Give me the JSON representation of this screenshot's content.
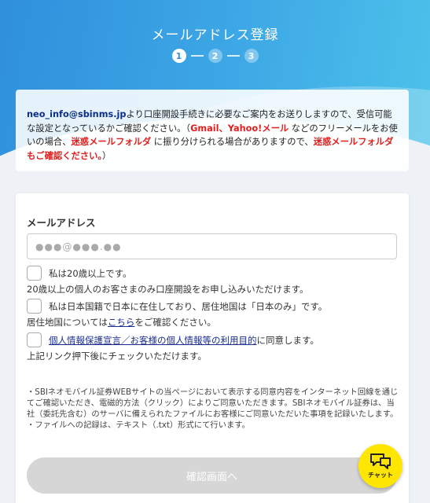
{
  "header": {
    "title": "メールアドレス登録",
    "steps": [
      "1",
      "2",
      "3"
    ],
    "active_step": 1
  },
  "notice": {
    "email": "neo_info@sbinms.jp",
    "text1": "より口座開設手続きに必要なご案内をお送りしますので、受信可能な設定となっているかご確認ください。（",
    "providers": "Gmail、Yahoo!メール",
    "text2": " などのフリーメールをお使いの場合、",
    "spam_folder": "迷惑メールフォルダ",
    "text3": " に振り分けられる場合がありますので、",
    "spam_check": "迷惑メールフォルダもご確認ください。",
    "text4": "）"
  },
  "form": {
    "email_label": "メールアドレス",
    "email_placeholder": "●●●@●●●.●●",
    "email_value": "",
    "age_check_label": "私は20歳以上です。",
    "age_note": "20歳以上の個人のお客さまのみ口座開設をお申し込みいただけます。",
    "residence_check_label": "私は日本国籍で日本に在住しており、居住地国は「日本のみ」です。",
    "residence_note_prefix": "居住地国については",
    "residence_note_link": "こちら",
    "residence_note_suffix": "をご確認ください。",
    "privacy_link": "個人情報保護宣言／お客様の個人情報等の利用目的",
    "privacy_suffix": "に同意します。",
    "privacy_note": "上記リンク押下後にチェックいただけます。",
    "disclaimer_1": "・SBIネオモバイル証券WEBサイトの当ページにおいて表示する同意内容をインターネット回線を通じてご確認いただき、電磁的方法（クリック）によりご同意いただきます。SBIネオモバイル証券は、当社（委託先含む）のサーバに備えられたファイルにお客様にご同意いただいた事項を記録いたします。",
    "disclaimer_2": "・ファイルへの記録は、テキスト（.txt）形式にて行います。",
    "confirm_button": "確認画面へ"
  },
  "chat": {
    "label": "チャット",
    "color": "#ffe600"
  }
}
